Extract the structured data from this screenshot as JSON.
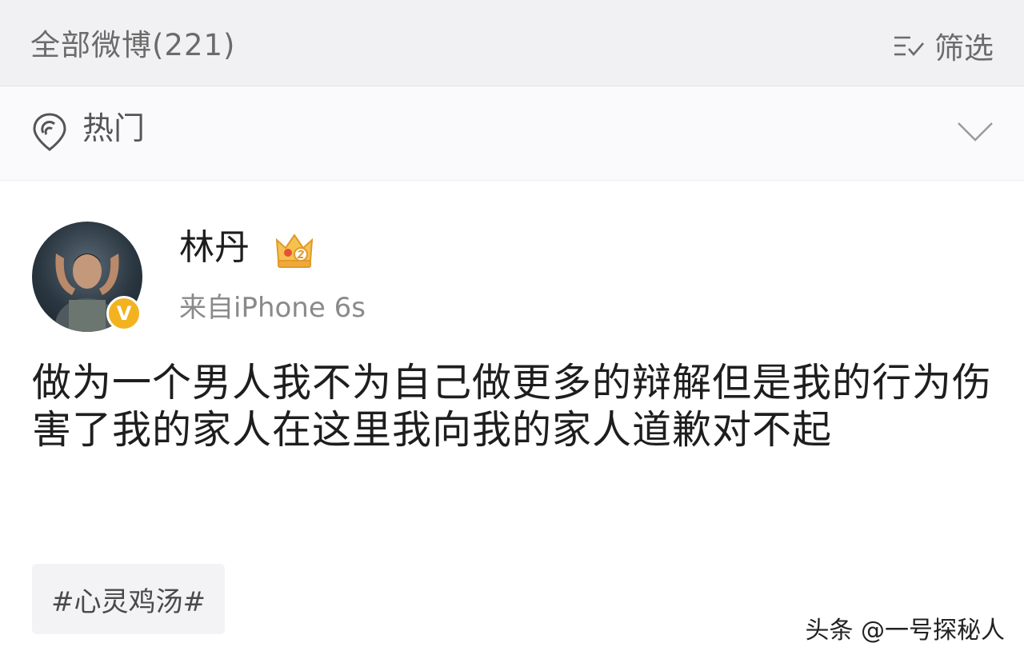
{
  "header": {
    "title": "全部微博(221)",
    "filter_label": "筛选",
    "filter_icon": "filter-check-icon"
  },
  "hot_section": {
    "label": "热门",
    "icon": "hot-pin-icon",
    "expand_icon": "chevron-down-icon"
  },
  "post": {
    "user_name": "林丹",
    "verified_badge": "V",
    "source": "来自iPhone 6s",
    "text": "做为一个男人我不为自己做更多的辩解但是我的行为伤害了我的家人在这里我向我的家人道歉对不起",
    "tag": "#心灵鸡汤#"
  },
  "watermark": "头条 @一号探秘人",
  "colors": {
    "header_bg": "#f1f1f3",
    "badge_gold": "#f3b320",
    "crown_gold": "#f0b64a"
  }
}
